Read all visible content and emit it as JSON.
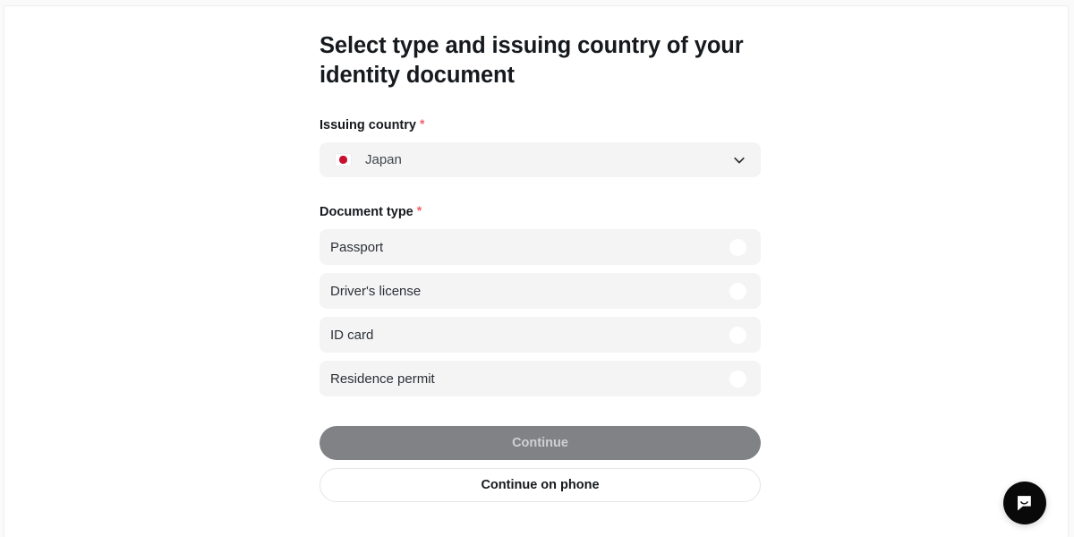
{
  "page": {
    "heading": "Select type and issuing country of your identity document"
  },
  "issuing_country": {
    "label": "Issuing country",
    "required_mark": "*",
    "selected_value": "Japan",
    "flag_icon": "japan-flag-icon",
    "chevron_icon": "chevron-down-icon",
    "accent_color": "#c8102e"
  },
  "document_type": {
    "label": "Document type",
    "required_mark": "*",
    "options": [
      {
        "label": "Passport",
        "selected": false
      },
      {
        "label": "Driver's license",
        "selected": false
      },
      {
        "label": "ID card",
        "selected": false
      },
      {
        "label": "Residence permit",
        "selected": false
      }
    ]
  },
  "actions": {
    "continue_label": "Continue",
    "continue_disabled": true,
    "continue_on_phone_label": "Continue on phone"
  },
  "chat_widget": {
    "icon": "chat-bubble-smile-icon",
    "color": "#090909"
  },
  "colors": {
    "field_background": "#f4f4f5",
    "required_asterisk": "#f1606a",
    "text_primary": "#16191d",
    "disabled_button": "#808285"
  }
}
